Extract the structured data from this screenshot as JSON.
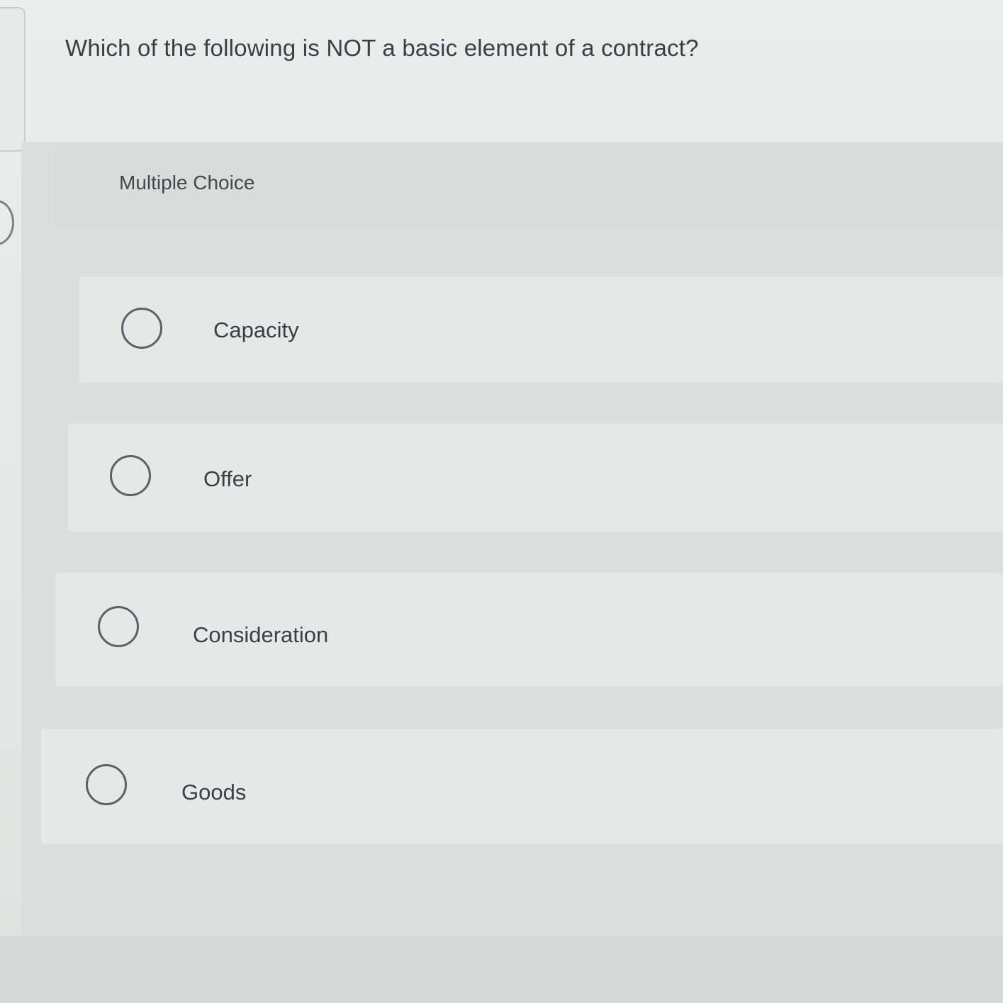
{
  "question": {
    "text": "Which of the following is NOT a basic element of a contract?"
  },
  "section": {
    "label": "Multiple Choice"
  },
  "options": [
    {
      "label": "Capacity",
      "selected": false
    },
    {
      "label": "Offer",
      "selected": false
    },
    {
      "label": "Consideration",
      "selected": false
    },
    {
      "label": "Goods",
      "selected": false
    }
  ],
  "colors": {
    "background": "#e3e7e5",
    "panel": "#dadedc",
    "option_card": "#e4e8e6",
    "text": "#3b3e46",
    "radio_border": "#5c6069"
  }
}
